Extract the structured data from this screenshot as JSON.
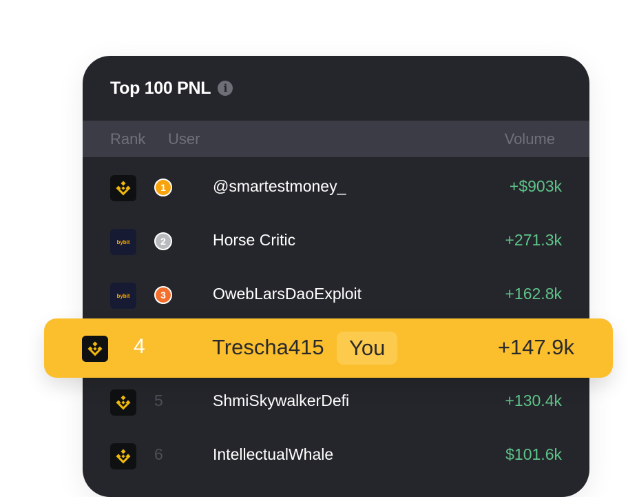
{
  "card": {
    "title": "Top 100 PNL",
    "info_icon": "i"
  },
  "columns": {
    "rank": "Rank",
    "user": "User",
    "volume": "Volume"
  },
  "rows": [
    {
      "exchange": "binance",
      "rank": "1",
      "medal_color": "#f7a30d",
      "user": "@smartestmoney_",
      "volume": "+$903k"
    },
    {
      "exchange": "bybit",
      "rank": "2",
      "medal_color": "#b9babd",
      "user": "Horse Critic",
      "volume": "+271.3k"
    },
    {
      "exchange": "bybit",
      "rank": "3",
      "medal_color": "#f46e2c",
      "user": "OwebLarsDaoExploit",
      "volume": "+162.8k"
    },
    {
      "exchange": "binance",
      "rank": "5",
      "user": "ShmiSkywalkerDefi",
      "volume": "+130.4k"
    },
    {
      "exchange": "binance",
      "rank": "6",
      "user": "IntellectualWhale",
      "volume": "$101.6k"
    }
  ],
  "current_user": {
    "exchange": "binance",
    "rank": "4",
    "user": "Trescha415",
    "badge": "You",
    "volume": "+147.9k"
  },
  "bybit_label": "bybit",
  "colors": {
    "positive": "#5fc48a",
    "highlight": "#fbbf2e",
    "card_bg": "#25262b"
  }
}
